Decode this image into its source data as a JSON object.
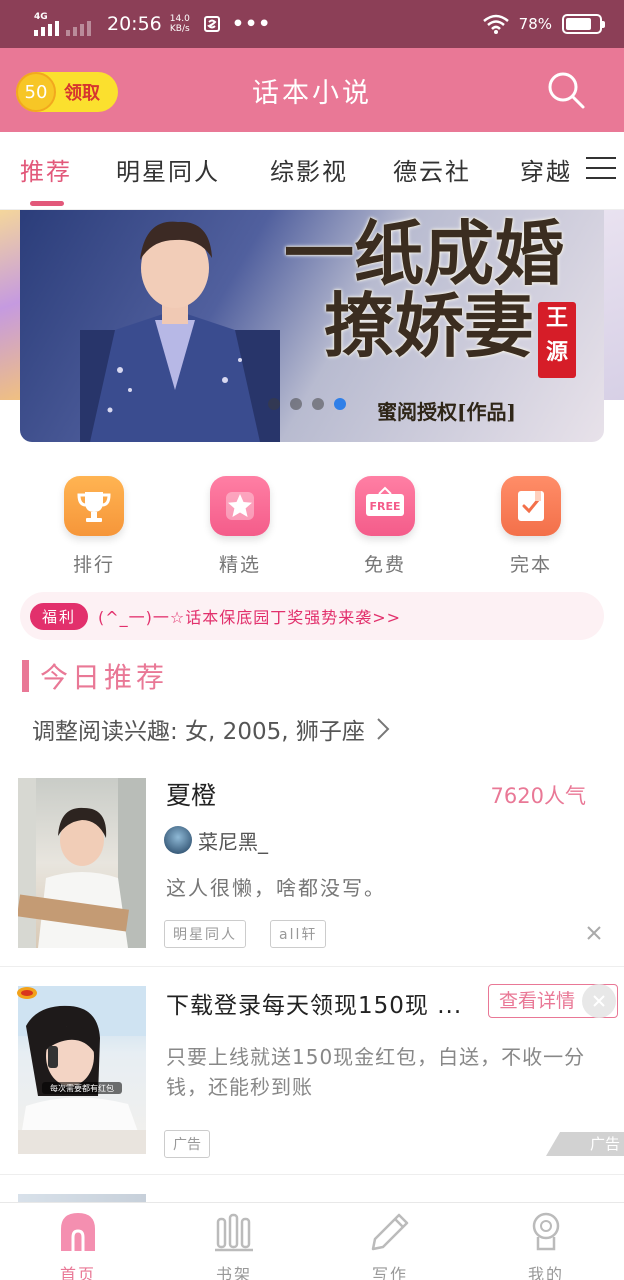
{
  "status_bar": {
    "network": "4G",
    "time": "20:56",
    "speed_value": "14.0",
    "speed_unit": "KB/s",
    "battery_percent": "78%",
    "battery_level": 0.78
  },
  "header": {
    "coins": "50",
    "claim_label": "领取",
    "title": "话本小说"
  },
  "tabs": [
    {
      "label": "推荐",
      "active": true
    },
    {
      "label": "明星同人",
      "active": false
    },
    {
      "label": "综影视",
      "active": false
    },
    {
      "label": "德云社",
      "active": false
    },
    {
      "label": "穿越",
      "active": false
    }
  ],
  "banner": {
    "title_line1": "一纸成婚",
    "title_line2": "撩娇妻",
    "stamp": "王源",
    "subtitle": "蜜阅授权[作品]",
    "pages": 4,
    "current_page": 4
  },
  "quick_links": [
    {
      "label": "排行",
      "icon": "trophy-icon",
      "color": "#f6963a"
    },
    {
      "label": "精选",
      "icon": "star-icon",
      "color": "#f45c8a"
    },
    {
      "label": "免费",
      "icon": "free-sign-icon",
      "color": "#f45c8a"
    },
    {
      "label": "完本",
      "icon": "check-book-icon",
      "color": "#f3704a"
    }
  ],
  "notice": {
    "badge": "福利",
    "text": "(^_一)一☆话本保底园丁奖强势来袭>>"
  },
  "section": {
    "title": "今日推荐",
    "interest": "调整阅读兴趣: 女, 2005, 狮子座"
  },
  "story": {
    "title": "夏橙",
    "popularity": "7620人气",
    "author": "菜尼黑_",
    "description": "这人很懒，啥都没写。",
    "tags": [
      "明星同人",
      "all轩"
    ]
  },
  "ad": {
    "title": "下载登录每天领现150现 ...",
    "button": "查看详情",
    "description": "只要上线就送150现金红包，白送，不收一分钱，还能秒到账",
    "tag": "广告",
    "mark": "广告",
    "image_caption": "每次需要都有红包"
  },
  "bottom_nav": [
    {
      "label": "首页",
      "icon": "home-icon",
      "active": true
    },
    {
      "label": "书架",
      "icon": "bookshelf-icon",
      "active": false
    },
    {
      "label": "写作",
      "icon": "pen-icon",
      "active": false
    },
    {
      "label": "我的",
      "icon": "profile-icon",
      "active": false
    }
  ],
  "colors": {
    "accent": "#e97896",
    "status_bar": "#8c3f57",
    "coin": "#fbe02e"
  }
}
